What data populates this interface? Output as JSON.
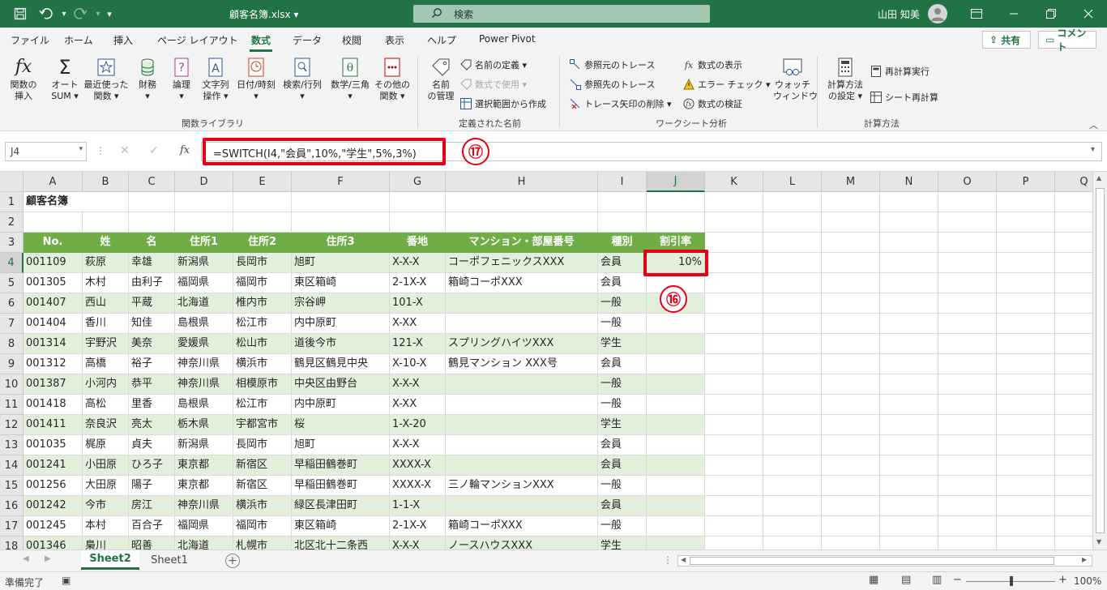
{
  "titlebar": {
    "doc_title": "顧客名簿.xlsx ▾",
    "search_label": "検索",
    "user_name": "山田 知美",
    "customize_glyph": "▾"
  },
  "tabs": [
    "ファイル",
    "ホーム",
    "挿入",
    "ページ レイアウト",
    "数式",
    "データ",
    "校閲",
    "表示",
    "ヘルプ",
    "Power Pivot"
  ],
  "active_tab": "数式",
  "share_label": "共有",
  "comment_label": "コメント",
  "ribbon": {
    "function_library": {
      "insert_function": [
        "関数の",
        "挿入"
      ],
      "autosum": [
        "オート",
        "SUM ▾"
      ],
      "recent": [
        "最近使った",
        "関数 ▾"
      ],
      "financial": [
        "財務",
        "▾"
      ],
      "logical": [
        "論理",
        "▾"
      ],
      "text": [
        "文字列",
        "操作 ▾"
      ],
      "datetime": [
        "日付/時刻",
        "▾"
      ],
      "lookup": [
        "検索/行列",
        "▾"
      ],
      "math": [
        "数学/三角",
        "▾"
      ],
      "more": [
        "その他の",
        "関数 ▾"
      ],
      "group_label": "関数ライブラリ"
    },
    "defined_names": {
      "name_manager": [
        "名前",
        "の管理"
      ],
      "define_name": "名前の定義 ▾",
      "use_in_formula": "数式で使用 ▾",
      "create_from_selection": "選択範囲から作成",
      "group_label": "定義された名前"
    },
    "auditing": {
      "trace_precedents": "参照元のトレース",
      "trace_dependents": "参照先のトレース",
      "remove_arrows": "トレース矢印の削除 ▾",
      "show_formulas": "数式の表示",
      "error_checking": "エラー チェック ▾",
      "evaluate_formula": "数式の検証",
      "watch_window": [
        "ウォッチ",
        "ウィンドウ"
      ],
      "group_label": "ワークシート分析"
    },
    "calculation": {
      "calc_options": [
        "計算方法",
        "の設定 ▾"
      ],
      "calc_now": "再計算実行",
      "calc_sheet": "シート再計算",
      "group_label": "計算方法"
    }
  },
  "formula_bar": {
    "name_box": "J4",
    "fx_label": "fx",
    "formula": "=SWITCH(I4,\"会員\",10%,\"学生\",5%,3%)"
  },
  "annotations": {
    "badge_17": "⑰",
    "badge_16": "⑯"
  },
  "columns": [
    "A",
    "B",
    "C",
    "D",
    "E",
    "F",
    "G",
    "H",
    "I",
    "J",
    "K",
    "L",
    "M",
    "N",
    "O",
    "P",
    "Q"
  ],
  "rows": [
    "1",
    "2",
    "3",
    "4",
    "5",
    "6",
    "7",
    "8",
    "9",
    "10",
    "11",
    "12",
    "13",
    "14",
    "15",
    "16",
    "17",
    "18"
  ],
  "sheet": {
    "title": "顧客名簿",
    "headers": [
      "No.",
      "姓",
      "名",
      "住所1",
      "住所2",
      "住所3",
      "番地",
      "マンション・部屋番号",
      "種別",
      "割引率"
    ],
    "data": [
      [
        "001109",
        "萩原",
        "幸雄",
        "新潟県",
        "長岡市",
        "旭町",
        "X-X-X",
        "コーポフェニックスXXX",
        "会員",
        "10%"
      ],
      [
        "001305",
        "木村",
        "由利子",
        "福岡県",
        "福岡市",
        "東区箱崎",
        "2-1X-X",
        "箱崎コーポXXX",
        "会員",
        ""
      ],
      [
        "001407",
        "西山",
        "平蔵",
        "北海道",
        "椎内市",
        "宗谷岬",
        "101-X",
        "",
        "一般",
        ""
      ],
      [
        "001404",
        "香川",
        "知佳",
        "島根県",
        "松江市",
        "内中原町",
        "X-XX",
        "",
        "一般",
        ""
      ],
      [
        "001314",
        "宇野沢",
        "美奈",
        "愛媛県",
        "松山市",
        "道後今市",
        "121-X",
        "スプリングハイツXXX",
        "学生",
        ""
      ],
      [
        "001312",
        "高橋",
        "裕子",
        "神奈川県",
        "横浜市",
        "鶴見区鶴見中央",
        "X-10-X",
        "鶴見マンション XXX号",
        "会員",
        ""
      ],
      [
        "001387",
        "小河内",
        "恭平",
        "神奈川県",
        "相模原市",
        "中央区由野台",
        "X-X-X",
        "",
        "一般",
        ""
      ],
      [
        "001418",
        "高松",
        "里香",
        "島根県",
        "松江市",
        "内中原町",
        "X-XX",
        "",
        "一般",
        ""
      ],
      [
        "001411",
        "奈良沢",
        "亮太",
        "栃木県",
        "宇都宮市",
        "桜",
        "1-X-20",
        "",
        "学生",
        ""
      ],
      [
        "001035",
        "梶原",
        "貞夫",
        "新潟県",
        "長岡市",
        "旭町",
        "X-X-X",
        "",
        "会員",
        ""
      ],
      [
        "001241",
        "小田原",
        "ひろ子",
        "東京都",
        "新宿区",
        "早稲田鶴巻町",
        "XXXX-X",
        "",
        "会員",
        ""
      ],
      [
        "001256",
        "大田原",
        "陽子",
        "東京都",
        "新宿区",
        "早稲田鶴巻町",
        "XXXX-X",
        "三ノ輪マンションXXX",
        "一般",
        ""
      ],
      [
        "001242",
        "今市",
        "房江",
        "神奈川県",
        "横浜市",
        "緑区長津田町",
        "1-1-X",
        "",
        "会員",
        ""
      ],
      [
        "001245",
        "本村",
        "百合子",
        "福岡県",
        "福岡市",
        "東区箱崎",
        "2-1X-X",
        "箱崎コーポXXX",
        "一般",
        ""
      ],
      [
        "001346",
        "梟川",
        "昭善",
        "北海道",
        "札幌市",
        "北区北十二条西",
        "X-X-X",
        "ノースハウスXXX",
        "学生",
        ""
      ]
    ]
  },
  "sheet_tabs": [
    "Sheet2",
    "Sheet1"
  ],
  "active_sheet": "Sheet2",
  "status": {
    "ready": "準備完了",
    "zoom": "100%"
  }
}
